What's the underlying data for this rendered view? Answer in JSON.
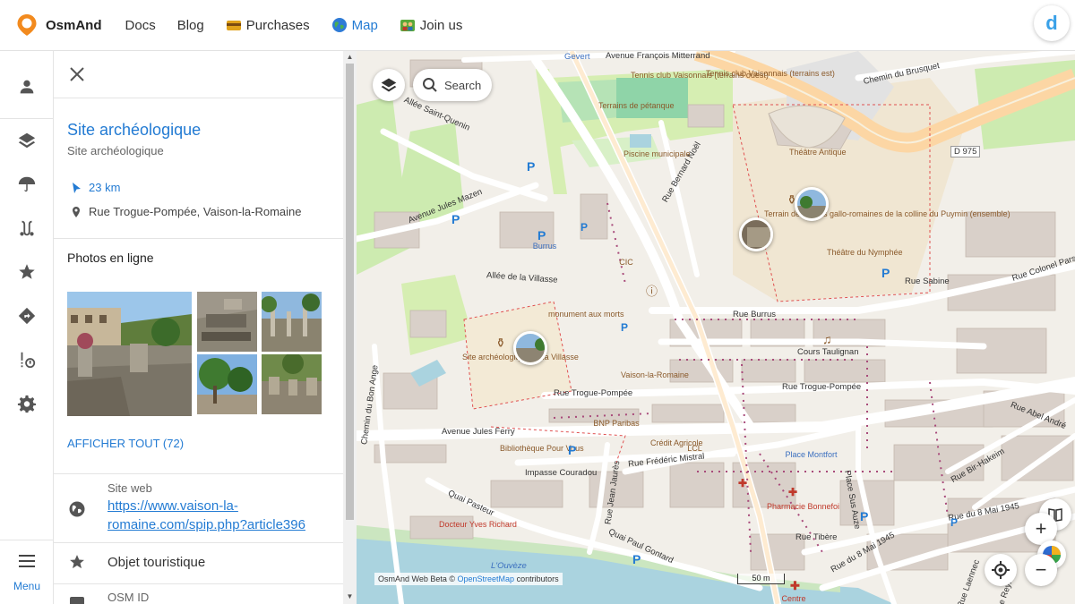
{
  "nav": {
    "brand": "OsmAnd",
    "items": [
      {
        "label": "Docs",
        "icon": "none"
      },
      {
        "label": "Blog",
        "icon": "none"
      },
      {
        "label": "Purchases",
        "icon": "wallet-icon"
      },
      {
        "label": "Map",
        "icon": "globe-icon"
      },
      {
        "label": "Join us",
        "icon": "people-icon"
      }
    ],
    "active": "Map",
    "avatar_letter": "d"
  },
  "rail": {
    "items": [
      "profile-icon",
      "layers-icon",
      "weather-umbrella-icon",
      "route-icon",
      "favorites-star-icon",
      "navigation-icon",
      "track-recording-icon",
      "settings-gear-icon"
    ],
    "menu_label": "Menu"
  },
  "panel": {
    "title": "Site archéologique",
    "subtitle": "Site archéologique",
    "distance": "23 km",
    "address": "Rue Trogue-Pompée, Vaison-la-Romaine",
    "photos_title": "Photos en ligne",
    "show_all": "AFFICHER TOUT (72)",
    "website_label": "Site web",
    "website_url": "https://www.vaison-la-romaine.com/spip.php?article396",
    "category": "Objet touristique",
    "osm_label": "OSM ID"
  },
  "map": {
    "search_label": "Search",
    "attribution_prefix": "OsmAnd Web Beta ©",
    "attribution_link": "OpenStreetMap",
    "attribution_suffix": "contributors",
    "scale": "50 m",
    "streets": {
      "s1": "Avenue François Mitterrand",
      "s2": "Chemin du Brusquet",
      "s3": "Allée Saint-Quenin",
      "s4": "Avenue Jules Mazen",
      "s5": "Rue Bernard Noël",
      "s6": "Allée de la Villasse",
      "s7": "Rue Sabine",
      "s8": "Rue Colonel Parson",
      "s9": "Rue Burrus",
      "s10": "Cours Taulignan",
      "s11": "Rue Trogue-Pompée",
      "s12": "Rue Trogue-Pompée",
      "s13": "Avenue Jules Ferry",
      "s14": "Rue Frédéric Mistral",
      "s15": "Impasse Couradou",
      "s16": "Chemin du Bon Ange",
      "s17": "Quai Pasteur",
      "s18": "Quai Paul Gontard",
      "s19": "Rue Jean Jaurès",
      "s20": "Place Sus Auze",
      "s21": "Rue Tibère",
      "s22": "Rue du 8 Mai 1945",
      "s23": "Rue du 8 Mai 1945",
      "s24": "Rue Bir-Hakeim",
      "s25": "Rue Abel André",
      "s26": "D 975",
      "s27": "L'Ouvèze",
      "s28": "Gevert",
      "s29": "Rue Laennec",
      "s30": "Rue Reyna"
    },
    "pois": {
      "p1": "Tennis club Vaisonnais (terrains ouest)",
      "p2": "Tennis club Vaisonnais (terrains est)",
      "p3": "Terrains de pétanque",
      "p4": "Piscine municipale",
      "p5": "Théâtre Antique",
      "p6": "Terrain de fouilles gallo-romaines de la colline du Puymin (ensemble)",
      "p7": "Théâtre du Nymphée",
      "p8": "Burrus",
      "p9": "CIC",
      "p10": "monument aux morts",
      "p11": "Site archéologique de la Villasse",
      "p12": "Vaison-la-Romaine",
      "p13": "BNP Paribas",
      "p14": "Crédit Agricole",
      "p15": "LCL",
      "p16": "Bibliothèque Pour Vous",
      "p17": "Place Montfort",
      "p18": "Pharmacie Bonnefoi",
      "p19": "Docteur Yves Richard",
      "p20": "Centre"
    }
  }
}
